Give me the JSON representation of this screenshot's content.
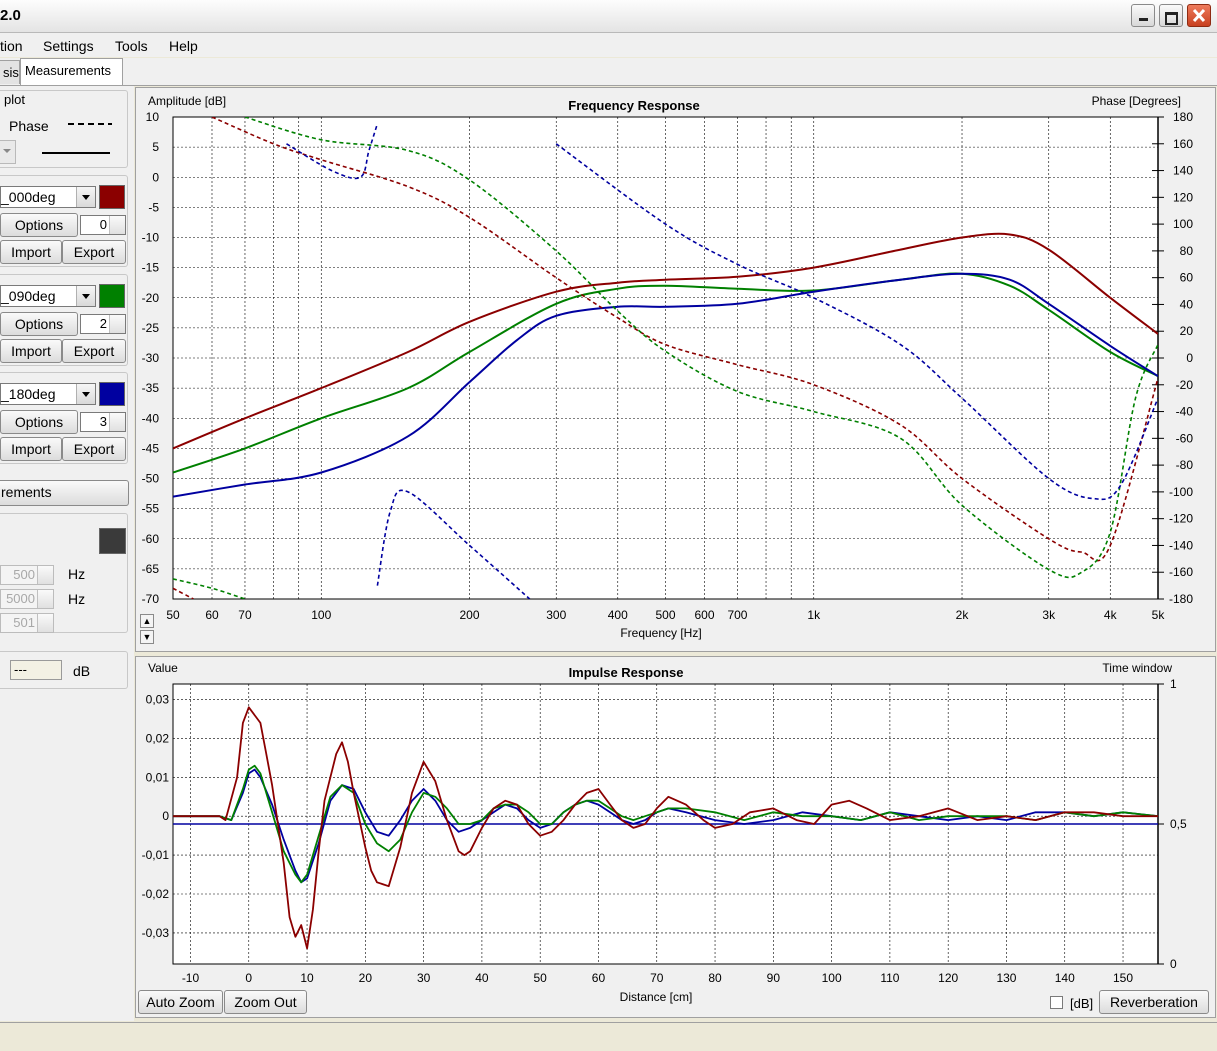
{
  "window": {
    "title": "2.0"
  },
  "menu": [
    "tion",
    "Settings",
    "Tools",
    "Help"
  ],
  "tabs": [
    "sis",
    "Measurements"
  ],
  "side": {
    "plot_group": {
      "label": "plot",
      "phase_label": "Phase"
    },
    "measurements": [
      {
        "name": "_000deg",
        "options_label": "Options",
        "options_value": "0",
        "import_label": "Import",
        "export_label": "Export",
        "color": "#8b0000"
      },
      {
        "name": "_090deg",
        "options_label": "Options",
        "options_value": "2",
        "import_label": "Import",
        "export_label": "Export",
        "color": "#008000"
      },
      {
        "name": "_180deg",
        "options_label": "Options",
        "options_value": "3",
        "import_label": "Import",
        "export_label": "Export",
        "color": "#0000a0"
      }
    ],
    "measurements_button": "rements",
    "dark_color": "#3a3a3a",
    "freq_fields": [
      {
        "value": "500",
        "unit": "Hz"
      },
      {
        "value": "5000",
        "unit": "Hz"
      },
      {
        "value": "501",
        "unit": ""
      }
    ],
    "db_field": {
      "value": "---",
      "unit": "dB"
    }
  },
  "freq_plot": {
    "arrows": {
      "up": "▲",
      "down": "▼"
    }
  },
  "impulse_controls": {
    "auto_zoom": "Auto Zoom",
    "zoom_out": "Zoom Out",
    "db_check": "[dB]",
    "reverberation": "Reverberation"
  },
  "chart_data": [
    {
      "type": "line",
      "title": "Frequency Response",
      "xlabel": "Frequency [Hz]",
      "ylabel": "Amplitude [dB]",
      "y2label": "Phase [Degrees]",
      "xscale": "log",
      "xlim": [
        50,
        5000
      ],
      "ylim": [
        -70,
        10
      ],
      "y2lim": [
        -180,
        180
      ],
      "grid": true,
      "x_ticks": [
        50,
        60,
        70,
        100,
        200,
        300,
        400,
        500,
        600,
        700,
        1000,
        2000,
        3000,
        4000,
        5000
      ],
      "x_tick_labels": [
        "50",
        "60",
        "70",
        "100",
        "200",
        "300",
        "400",
        "500",
        "600",
        "700",
        "1k",
        "2k",
        "3k",
        "4k",
        "5k"
      ],
      "y_ticks": [
        "10",
        "5",
        "0",
        "-5",
        "-10",
        "-15",
        "-20",
        "-25",
        "-30",
        "-35",
        "-40",
        "-45",
        "-50",
        "-55",
        "-60",
        "-65",
        "-70"
      ],
      "y2_ticks": [
        "180",
        "160",
        "140",
        "120",
        "100",
        "80",
        "60",
        "40",
        "20",
        "0",
        "-20",
        "-40",
        "-60",
        "-80",
        "-100",
        "-120",
        "-140",
        "-160",
        "-180"
      ],
      "series": [
        {
          "color": "#8b0000",
          "kind": "amplitude",
          "x": [
            50,
            70,
            100,
            150,
            200,
            300,
            400,
            500,
            700,
            1000,
            1500,
            2000,
            2500,
            3000,
            4000,
            5000
          ],
          "y": [
            -45,
            -40,
            -35,
            -29,
            -24,
            -19,
            -17.5,
            -17,
            -16.5,
            -15,
            -12,
            -10,
            -9.5,
            -12,
            -20,
            -26
          ]
        },
        {
          "color": "#008000",
          "kind": "amplitude",
          "x": [
            50,
            70,
            100,
            150,
            200,
            300,
            400,
            500,
            700,
            1000,
            1500,
            2000,
            2500,
            3000,
            4000,
            5000
          ],
          "y": [
            -49,
            -45,
            -40,
            -35,
            -29,
            -21,
            -18.5,
            -18,
            -18.5,
            -18.8,
            -17,
            -16,
            -18,
            -22,
            -29,
            -33
          ]
        },
        {
          "color": "#0000a0",
          "kind": "amplitude",
          "x": [
            50,
            70,
            100,
            150,
            200,
            250,
            300,
            400,
            500,
            700,
            1000,
            1500,
            2000,
            2500,
            3000,
            4000,
            5000
          ],
          "y": [
            -53,
            -51,
            -49,
            -43,
            -34,
            -27,
            -23,
            -21.5,
            -21.5,
            -21,
            -19,
            -17,
            -16,
            -17,
            -21,
            -28,
            -33
          ]
        },
        {
          "color": "#8b0000",
          "kind": "phase",
          "x": [
            60,
            80,
            100,
            150,
            200,
            300,
            400,
            500,
            700,
            1000,
            1500,
            2000,
            3000,
            3500,
            4000,
            5000
          ],
          "y": [
            180,
            160,
            148,
            128,
            105,
            60,
            30,
            10,
            -5,
            -20,
            -50,
            -90,
            -135,
            -145,
            -140,
            -15
          ]
        },
        {
          "color": "#008000",
          "kind": "phase",
          "x": [
            70,
            100,
            150,
            200,
            300,
            400,
            500,
            700,
            1000,
            1500,
            2000,
            3000,
            3500,
            4000,
            4500,
            5000
          ],
          "y": [
            180,
            163,
            155,
            133,
            80,
            35,
            5,
            -25,
            -40,
            -60,
            -110,
            -158,
            -160,
            -130,
            -30,
            10
          ]
        },
        {
          "color": "#0000a0",
          "kind": "phase",
          "x": [
            300,
            500,
            700,
            1000,
            1500,
            2000,
            3000,
            3700,
            4200,
            5000
          ],
          "y": [
            160,
            100,
            70,
            45,
            10,
            -30,
            -90,
            -105,
            -95,
            -30
          ]
        },
        {
          "color": "#0000a0",
          "kind": "phase",
          "x": [
            85,
            105,
            120,
            125,
            130
          ],
          "y": [
            160,
            140,
            135,
            155,
            175
          ]
        },
        {
          "color": "#0000a0",
          "kind": "phase",
          "x": [
            130,
            138,
            150,
            200,
            265
          ],
          "y": [
            -170,
            -115,
            -100,
            -140,
            -180
          ]
        },
        {
          "color": "#008000",
          "kind": "phase",
          "x": [
            50,
            60,
            70
          ],
          "y": [
            -165,
            -172,
            -180
          ]
        },
        {
          "color": "#8b0000",
          "kind": "phase",
          "x": [
            50,
            55
          ],
          "y": [
            -172,
            -180
          ]
        }
      ]
    },
    {
      "type": "line",
      "title": "Impulse Response",
      "xlabel": "Distance [cm]",
      "ylabel": "Value",
      "y2label": "Time window",
      "xlim": [
        -13,
        156
      ],
      "ylim": [
        -0.038,
        0.034
      ],
      "y2lim": [
        0,
        1
      ],
      "grid": true,
      "x_ticks": [
        -10,
        0,
        10,
        20,
        30,
        40,
        50,
        60,
        70,
        80,
        90,
        100,
        110,
        120,
        130,
        140,
        150
      ],
      "y_ticks": [
        0.03,
        0.02,
        0.01,
        0,
        -0.01,
        -0.02,
        -0.03
      ],
      "y_tick_labels": [
        "0,03",
        "0,02",
        "0,01",
        "0",
        "-0,01",
        "-0,02",
        "-0,03"
      ],
      "y2_ticks": [
        1,
        0.5,
        0
      ],
      "y2_tick_labels": [
        "1",
        "0,5",
        "0"
      ],
      "series": [
        {
          "color": "#0000a0",
          "x": [
            -13,
            -5,
            -3,
            -1,
            0,
            1,
            2,
            4,
            6,
            8,
            9,
            10,
            12,
            14,
            16,
            18,
            20,
            22,
            24,
            26,
            28,
            30,
            32,
            34,
            36,
            38,
            40,
            42,
            44,
            46,
            48,
            50,
            52,
            54,
            56,
            58,
            60,
            62,
            64,
            66,
            68,
            70,
            72,
            75,
            80,
            85,
            90,
            95,
            100,
            105,
            110,
            115,
            120,
            125,
            130,
            135,
            140,
            145,
            150,
            156
          ],
          "y": [
            0,
            0,
            -0.001,
            0.006,
            0.011,
            0.012,
            0.01,
            0.003,
            -0.006,
            -0.014,
            -0.017,
            -0.016,
            -0.007,
            0.004,
            0.008,
            0.007,
            0.001,
            -0.004,
            -0.005,
            -0.001,
            0.004,
            0.007,
            0.004,
            -0.001,
            -0.004,
            -0.003,
            -0.001,
            0.001,
            0.003,
            0.002,
            -0.001,
            -0.003,
            -0.002,
            0.001,
            0.003,
            0.004,
            0.003,
            0.001,
            -0.001,
            -0.002,
            -0.001,
            0.001,
            0.002,
            0.001,
            -0.001,
            -0.002,
            -0.001,
            0.001,
            0,
            -0.001,
            0.001,
            0,
            -0.001,
            0,
            -0.001,
            0.001,
            0.001,
            0,
            0.001,
            0
          ]
        },
        {
          "color": "#008000",
          "x": [
            -13,
            -5,
            -3,
            -1,
            0,
            1,
            2,
            4,
            6,
            8,
            9,
            10,
            12,
            14,
            16,
            18,
            20,
            22,
            24,
            26,
            28,
            30,
            32,
            34,
            36,
            38,
            40,
            42,
            44,
            46,
            48,
            50,
            52,
            54,
            56,
            58,
            60,
            62,
            64,
            66,
            68,
            70,
            72,
            75,
            80,
            85,
            90,
            95,
            100,
            105,
            110,
            115,
            120,
            125,
            130,
            135,
            140,
            145,
            150,
            156
          ],
          "y": [
            0,
            0,
            -0.001,
            0.007,
            0.012,
            0.013,
            0.011,
            0.001,
            -0.009,
            -0.015,
            -0.017,
            -0.015,
            -0.005,
            0.005,
            0.008,
            0.006,
            -0.002,
            -0.007,
            -0.009,
            -0.006,
            0.001,
            0.006,
            0.005,
            0.002,
            -0.002,
            -0.002,
            -0.001,
            0.002,
            0.003,
            0.003,
            0.001,
            -0.002,
            -0.002,
            0.001,
            0.003,
            0.004,
            0.004,
            0.002,
            0,
            -0.001,
            0,
            0.001,
            0.002,
            0.002,
            0.001,
            -0.001,
            0.001,
            0,
            0,
            -0.001,
            0.001,
            -0.001,
            0,
            0,
            0,
            -0.001,
            0.001,
            0,
            0.001,
            0
          ]
        },
        {
          "color": "#8b0000",
          "x": [
            -13,
            -5,
            -4,
            -2,
            -1,
            0,
            1,
            2,
            3,
            4,
            6,
            7,
            8,
            9,
            10,
            11,
            12,
            13,
            15,
            16,
            17,
            18,
            19,
            20,
            21,
            22,
            24,
            26,
            28,
            30,
            32,
            34,
            36,
            37,
            38,
            40,
            42,
            44,
            46,
            48,
            50,
            52,
            54,
            56,
            58,
            60,
            62,
            64,
            66,
            68,
            70,
            72,
            75,
            78,
            80,
            83,
            86,
            90,
            94,
            97,
            100,
            103,
            106,
            110,
            115,
            120,
            125,
            130,
            135,
            140,
            145,
            150,
            156
          ],
          "y": [
            0,
            0,
            -0.001,
            0.01,
            0.024,
            0.028,
            0.026,
            0.024,
            0.016,
            0.008,
            -0.012,
            -0.026,
            -0.031,
            -0.028,
            -0.034,
            -0.024,
            -0.009,
            0.004,
            0.016,
            0.019,
            0.014,
            0.006,
            -0.001,
            -0.008,
            -0.014,
            -0.017,
            -0.018,
            -0.008,
            0.006,
            0.014,
            0.009,
            -0.001,
            -0.009,
            -0.01,
            -0.009,
            -0.003,
            0.002,
            0.004,
            0.003,
            -0.002,
            -0.005,
            -0.004,
            -0.001,
            0.003,
            0.006,
            0.007,
            0.003,
            -0.001,
            -0.003,
            -0.002,
            0.002,
            0.005,
            0.003,
            -0.001,
            -0.003,
            -0.002,
            0.001,
            0.002,
            -0.001,
            -0.002,
            0.003,
            0.004,
            0.002,
            -0.001,
            0,
            0.002,
            -0.001,
            0,
            -0.001,
            0.001,
            0.001,
            0,
            0
          ]
        }
      ],
      "time_window": {
        "color": "#0000a0",
        "x": [
          -13,
          156
        ],
        "y": [
          0.5,
          0.5
        ]
      }
    }
  ]
}
